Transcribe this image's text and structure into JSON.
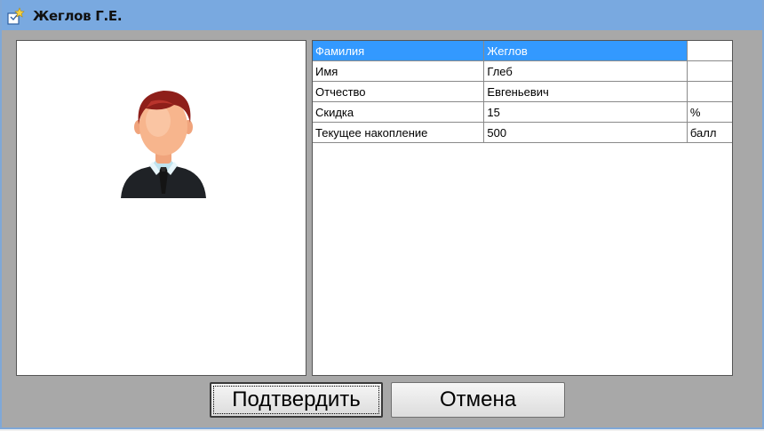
{
  "window": {
    "title": "Жеглов Г.Е.",
    "icon": "edit-card-icon"
  },
  "photo": {
    "icon": "user-avatar-icon"
  },
  "properties": [
    {
      "name": "Фамилия",
      "value": "Жеглов",
      "unit": "",
      "selected": true
    },
    {
      "name": "Имя",
      "value": "Глеб",
      "unit": "",
      "selected": false
    },
    {
      "name": "Отчество",
      "value": "Евгеньевич",
      "unit": "",
      "selected": false
    },
    {
      "name": "Скидка",
      "value": "15",
      "unit": "%",
      "selected": false
    },
    {
      "name": "Текущее накопление",
      "value": "500",
      "unit": "балл",
      "selected": false
    }
  ],
  "buttons": {
    "confirm": "Подтвердить",
    "cancel": "Отмена"
  },
  "colors": {
    "titlebar": "#79a9e0",
    "selection": "#3399ff",
    "window_background": "#a8a8a8"
  }
}
